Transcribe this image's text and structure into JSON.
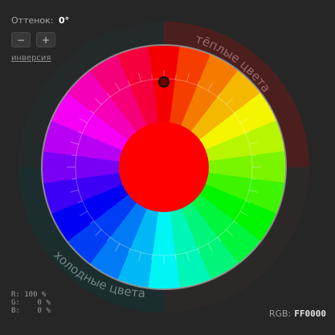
{
  "hue": {
    "label": "Оттенок:",
    "value": "0°"
  },
  "controls": {
    "minus_label": "−",
    "plus_label": "+",
    "invert_label": "инверсия"
  },
  "arcs": {
    "warm": "тёплые цвета",
    "cold": "холодные цвета"
  },
  "rgb": {
    "r": "R: 100 %",
    "g": "G:    0 %",
    "b": "B:    0 %",
    "hex_label": "RGB:",
    "hex_value": "FF0000"
  },
  "colors": {
    "selected": "#ff0000",
    "background": "#262626",
    "warm_arc_tint": "#5a1a1a",
    "cold_arc_tint": "#1b3333"
  },
  "wheel": {
    "segments": 24,
    "selected_hue_deg": 0
  }
}
